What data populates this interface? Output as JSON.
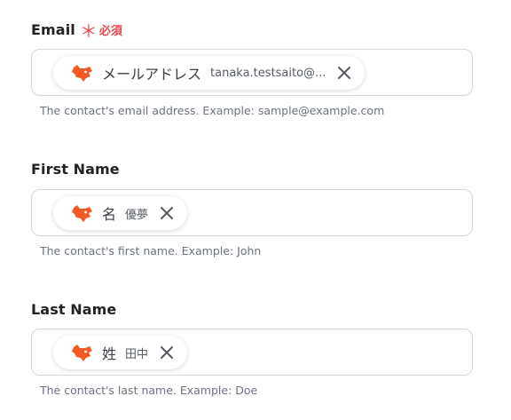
{
  "fields": [
    {
      "label": "Email",
      "required_mark": "＊",
      "required_text": "必須",
      "chip": {
        "label": "メールアドレス",
        "value": "tanaka.testsaito@..."
      },
      "help": "The contact's email address. Example: sample@example.com"
    },
    {
      "label": "First Name",
      "chip": {
        "label": "名",
        "value": "優夢"
      },
      "help": "The contact's first name. Example: John"
    },
    {
      "label": "Last Name",
      "chip": {
        "label": "姓",
        "value": "田中"
      },
      "help": "The contact's last name. Example: Doe"
    }
  ],
  "icons": {
    "chip_logo": "fox-logo-icon",
    "chip_remove": "close-icon"
  },
  "colors": {
    "required": "#e5484d",
    "logo": "#f15a24",
    "border": "#d4d7dc",
    "help_text": "#6b7280"
  }
}
